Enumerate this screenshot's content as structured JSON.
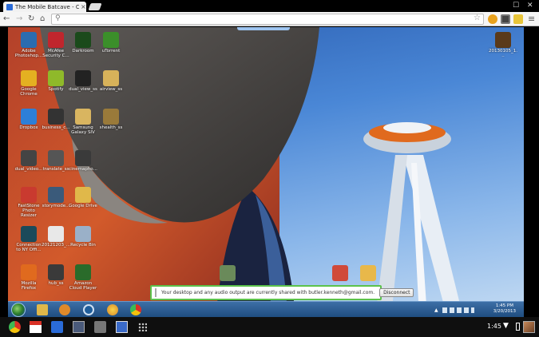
{
  "browser": {
    "tab_title": "The Mobile Batcave - Ch",
    "tab_close": "×",
    "omnibox_value": "",
    "win_minimize": "☐",
    "win_close": "✕"
  },
  "desktop_icons": [
    {
      "label": "Adobe Photoshop...",
      "color": "#2b6cb0"
    },
    {
      "label": "McAfee Security C...",
      "color": "#c0262d"
    },
    {
      "label": "Darkroom",
      "color": "#1b4a1b"
    },
    {
      "label": "uTorrent",
      "color": "#3b8f2a"
    },
    {
      "label": "Google Chrome",
      "color": "#e4b021"
    },
    {
      "label": "Spotify",
      "color": "#8fb92a"
    },
    {
      "label": "dual_view_ss",
      "color": "#222222"
    },
    {
      "label": "airview_ss",
      "color": "#d7b25a"
    },
    {
      "label": "Dropbox",
      "color": "#2d7fd8"
    },
    {
      "label": "business_c...",
      "color": "#333333"
    },
    {
      "label": "Samsung Galaxy SIV",
      "color": "#d9b560"
    },
    {
      "label": "shealth_ss",
      "color": "#9a7a3a"
    },
    {
      "label": "dual_video...",
      "color": "#444444"
    },
    {
      "label": "translate_ss",
      "color": "#555555"
    },
    {
      "label": "cinemapho...",
      "color": "#3a3a3a"
    },
    {
      "label": "FastStone Photo Resizer",
      "color": "#c93a2f"
    },
    {
      "label": "storymode...",
      "color": "#3a5a7a"
    },
    {
      "label": "Google Drive",
      "color": "#e0b84a"
    },
    {
      "label": "Connection to NY Offi...",
      "color": "#1b4a5a"
    },
    {
      "label": "20121203_...",
      "color": "#e8e8e8"
    },
    {
      "label": "Recycle Bin",
      "color": "#9ab0c8"
    },
    {
      "label": "Mozilla Firefox",
      "color": "#e06a1e"
    },
    {
      "label": "hub_ss",
      "color": "#3a3a3a"
    },
    {
      "label": "Amazon Cloud Player",
      "color": "#2a6b2a"
    },
    {
      "label": "20130105_1...",
      "color": "#5a3a1a"
    }
  ],
  "share_bar": {
    "message": "Your desktop and any audio output are currently shared with butler.kenneth@gmail.com.",
    "button_label": "Disconnect"
  },
  "windows_tray": {
    "time": "1:45 PM",
    "date": "3/20/2013"
  },
  "shelf": {
    "clock": "1:45"
  }
}
